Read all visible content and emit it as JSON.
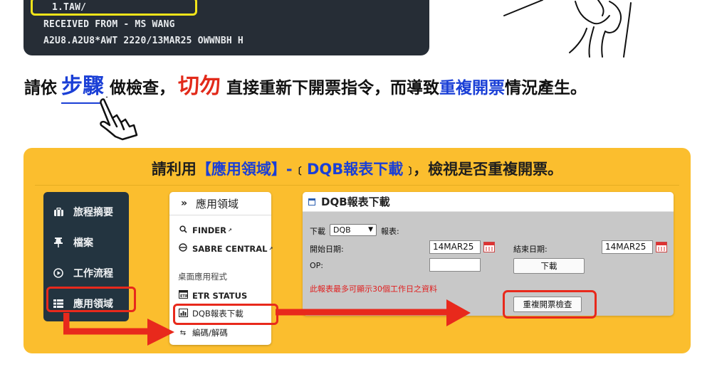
{
  "terminal": {
    "line1": "1.TAW/",
    "line2": "RECEIVED FROM - MS WANG",
    "line3": "A2U8.A2U8*AWT 2220/13MAR25 OWWNBH H"
  },
  "headline": {
    "part1": "請依",
    "step": "步驟",
    "part2": "做檢查，",
    "stop": "切勿",
    "part3": "直接重新下開票指令，而導致",
    "highlight": "重複開票",
    "part4": "情況產生。"
  },
  "panel": {
    "title_prefix": "請利用",
    "title_domain": "【應用領域】",
    "title_dash": "-",
    "bracket_open": "〔",
    "title_report": "DQB報表下載",
    "bracket_close": "〕",
    "title_suffix": "，檢視是否重複開票。"
  },
  "nav": {
    "items": [
      {
        "label": "旅程摘要",
        "icon": "suitcase-icon"
      },
      {
        "label": "檔案",
        "icon": "pin-icon"
      },
      {
        "label": "工作流程",
        "icon": "play-circle-icon"
      },
      {
        "label": "應用領域",
        "icon": "grid-icon"
      }
    ]
  },
  "menu": {
    "header": "應用領域",
    "finder": "FINDER",
    "sabre_central": "SABRE CENTRAL",
    "section": "桌面應用程式",
    "etr_status": "ETR STATUS",
    "dqb_download": "DQB報表下載",
    "encode_decode": "編碼/解碼"
  },
  "report": {
    "title": "DQB報表下載",
    "download_label": "下載",
    "select_value": "DQB",
    "report_label": "報表:",
    "start_date_label": "開始日期:",
    "start_date_value": "14MAR25",
    "end_date_label": "結束日期:",
    "end_date_value": "14MAR25",
    "op_label": "OP:",
    "op_value": "",
    "download_button": "下載",
    "warning": "此報表最多可顯示30個工作日之資料",
    "duplicate_check_button": "重複開票檢查"
  },
  "colors": {
    "panel_yellow": "#fbbe2e",
    "highlight_red": "#e8291c",
    "accent_blue": "#1a3fd6",
    "terminal_bg": "#262d36",
    "sidebar_bg": "#233440"
  }
}
